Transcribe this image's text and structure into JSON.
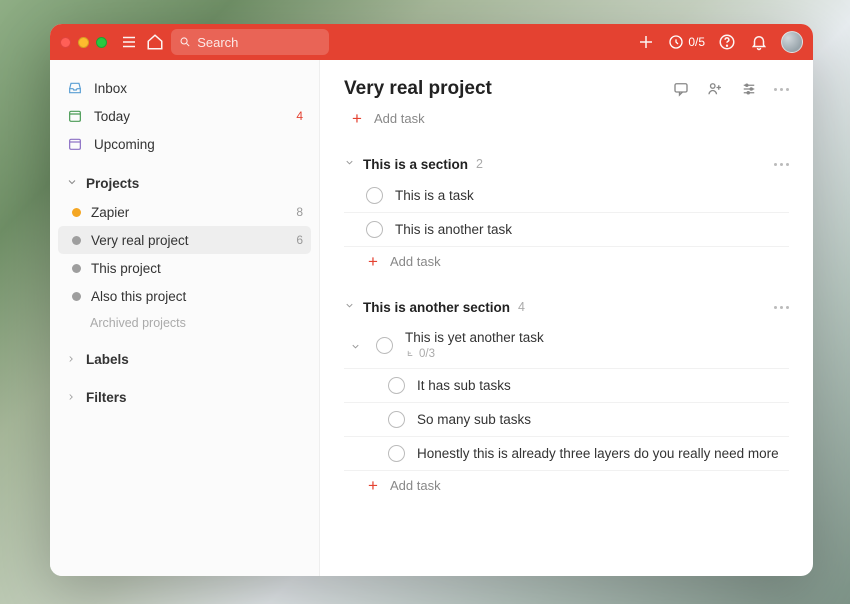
{
  "header": {
    "search_placeholder": "Search",
    "karma": "0/5"
  },
  "sidebar": {
    "inbox": "Inbox",
    "today": "Today",
    "today_count": "4",
    "upcoming": "Upcoming",
    "projects_label": "Projects",
    "projects": [
      {
        "name": "Zapier",
        "count": "8",
        "color": "#F4A623"
      },
      {
        "name": "Very real project",
        "count": "6",
        "color": "#9e9e9e",
        "active": true
      },
      {
        "name": "This project",
        "color": "#9e9e9e"
      },
      {
        "name": "Also this project",
        "color": "#9e9e9e"
      }
    ],
    "archived": "Archived projects",
    "labels": "Labels",
    "filters": "Filters"
  },
  "main": {
    "title": "Very real project",
    "add_task": "Add task",
    "sections": [
      {
        "title": "This is a section",
        "count": "2",
        "tasks": [
          {
            "text": "This is a task"
          },
          {
            "text": "This is another task"
          }
        ]
      },
      {
        "title": "This is another section",
        "count": "4",
        "tasks": [
          {
            "text": "This is yet another task",
            "subcount": "0/3",
            "expandable": true,
            "subtasks": [
              {
                "text": "It has sub tasks"
              },
              {
                "text": "So many sub tasks"
              },
              {
                "text": "Honestly this is already three layers do you really need more"
              }
            ]
          }
        ]
      }
    ]
  }
}
